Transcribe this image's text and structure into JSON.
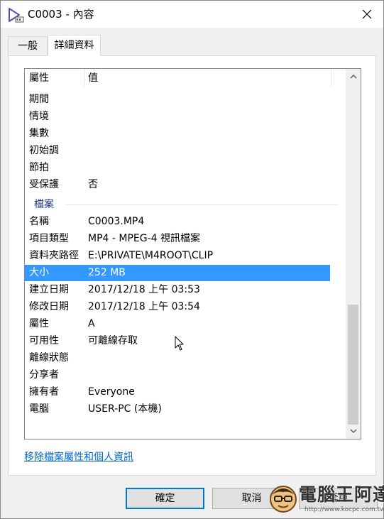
{
  "window": {
    "title": "C0003 - 內容"
  },
  "tabs": [
    {
      "label": "一般"
    },
    {
      "label": "詳細資料"
    }
  ],
  "columns": {
    "property": "屬性",
    "value": "值"
  },
  "rows_top": [
    {
      "prop": "期間",
      "val": ""
    },
    {
      "prop": "情境",
      "val": ""
    },
    {
      "prop": "集數",
      "val": ""
    },
    {
      "prop": "初始調",
      "val": ""
    },
    {
      "prop": "節拍",
      "val": ""
    },
    {
      "prop": "受保護",
      "val": "否"
    }
  ],
  "group": {
    "label": "檔案"
  },
  "rows_file": [
    {
      "prop": "名稱",
      "val": "C0003.MP4"
    },
    {
      "prop": "項目類型",
      "val": "MP4 - MPEG-4 視訊檔案"
    },
    {
      "prop": "資料夾路徑",
      "val": "E:\\PRIVATE\\M4ROOT\\CLIP"
    },
    {
      "prop": "大小",
      "val": "252 MB"
    },
    {
      "prop": "建立日期",
      "val": "2017/12/18 上午 03:53"
    },
    {
      "prop": "修改日期",
      "val": "2017/12/18 上午 03:54"
    },
    {
      "prop": "屬性",
      "val": "A"
    },
    {
      "prop": "可用性",
      "val": "可離線存取"
    },
    {
      "prop": "離線狀態",
      "val": ""
    },
    {
      "prop": "分享者",
      "val": ""
    },
    {
      "prop": "擁有者",
      "val": "Everyone"
    },
    {
      "prop": "電腦",
      "val": "USER-PC (本機)"
    }
  ],
  "remove_link": "移除檔案屬性和個人資訊",
  "buttons": {
    "ok": "確定",
    "cancel": "取消",
    "apply": "套用"
  },
  "watermark": {
    "text": "電腦王阿達",
    "url": "http://www.kocpc.com.tw"
  },
  "colors": {
    "selection": "#3399ff",
    "group_header": "#1e3287",
    "link": "#0066cc",
    "focus_border": "#0078d7"
  }
}
